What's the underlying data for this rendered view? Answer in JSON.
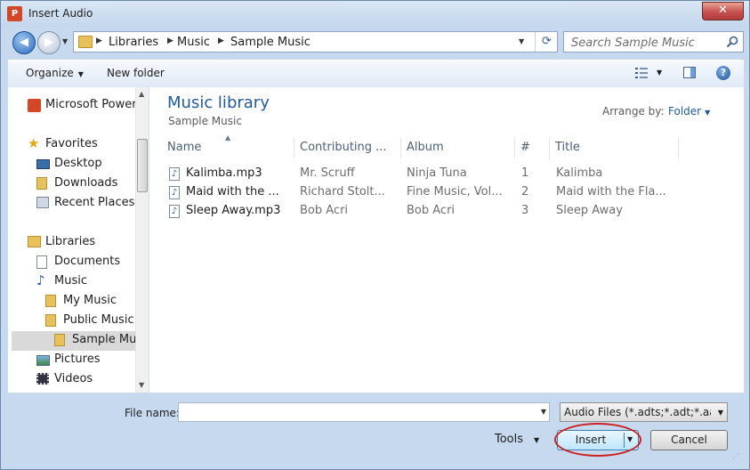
{
  "window": {
    "title": "Insert Audio",
    "app_icon": "P",
    "close_glyph": "✕"
  },
  "nav": {
    "back_glyph": "◀",
    "forward_glyph": "▶",
    "breadcrumbs": [
      "Libraries",
      "Music",
      "Sample Music"
    ],
    "search_placeholder": "Search Sample Music"
  },
  "toolbar": {
    "organize": "Organize",
    "new_folder": "New folder"
  },
  "sidebar": {
    "items": [
      {
        "label": "Microsoft PowerPoint",
        "icon": "powerpoint-icon"
      },
      {
        "label": "Favorites",
        "icon": "star-icon"
      },
      {
        "label": "Desktop",
        "icon": "desktop-icon"
      },
      {
        "label": "Downloads",
        "icon": "downloads-folder-icon"
      },
      {
        "label": "Recent Places",
        "icon": "recent-places-icon"
      },
      {
        "label": "Libraries",
        "icon": "libraries-icon"
      },
      {
        "label": "Documents",
        "icon": "documents-icon"
      },
      {
        "label": "Music",
        "icon": "music-note-icon"
      },
      {
        "label": "My Music",
        "icon": "folder-icon"
      },
      {
        "label": "Public Music",
        "icon": "folder-icon"
      },
      {
        "label": "Sample Music",
        "icon": "folder-icon"
      },
      {
        "label": "Pictures",
        "icon": "pictures-icon"
      },
      {
        "label": "Videos",
        "icon": "videos-icon"
      }
    ]
  },
  "library": {
    "title": "Music library",
    "subtitle": "Sample Music",
    "arrange_label": "Arrange by:",
    "arrange_value": "Folder"
  },
  "columns": [
    "Name",
    "Contributing ...",
    "Album",
    "#",
    "Title"
  ],
  "files": [
    {
      "name": "Kalimba.mp3",
      "artist": "Mr. Scruff",
      "album": "Ninja Tuna",
      "num": "1",
      "title": "Kalimba"
    },
    {
      "name": "Maid with the ...",
      "artist": "Richard Stolt...",
      "album": "Fine Music, Vol...",
      "num": "2",
      "title": "Maid with the Fla..."
    },
    {
      "name": "Sleep Away.mp3",
      "artist": "Bob Acri",
      "album": "Bob Acri",
      "num": "3",
      "title": "Sleep Away"
    }
  ],
  "footer": {
    "file_name_label": "File name:",
    "file_name_value": "",
    "filter": "Audio Files (*.adts;*.adt;*.aac;*.",
    "tools": "Tools",
    "insert": "Insert",
    "cancel": "Cancel"
  },
  "colors": {
    "accent": "#1e5a9c",
    "highlight_ring": "#cc1f1f",
    "selected_bg": "#d9d9d9"
  }
}
